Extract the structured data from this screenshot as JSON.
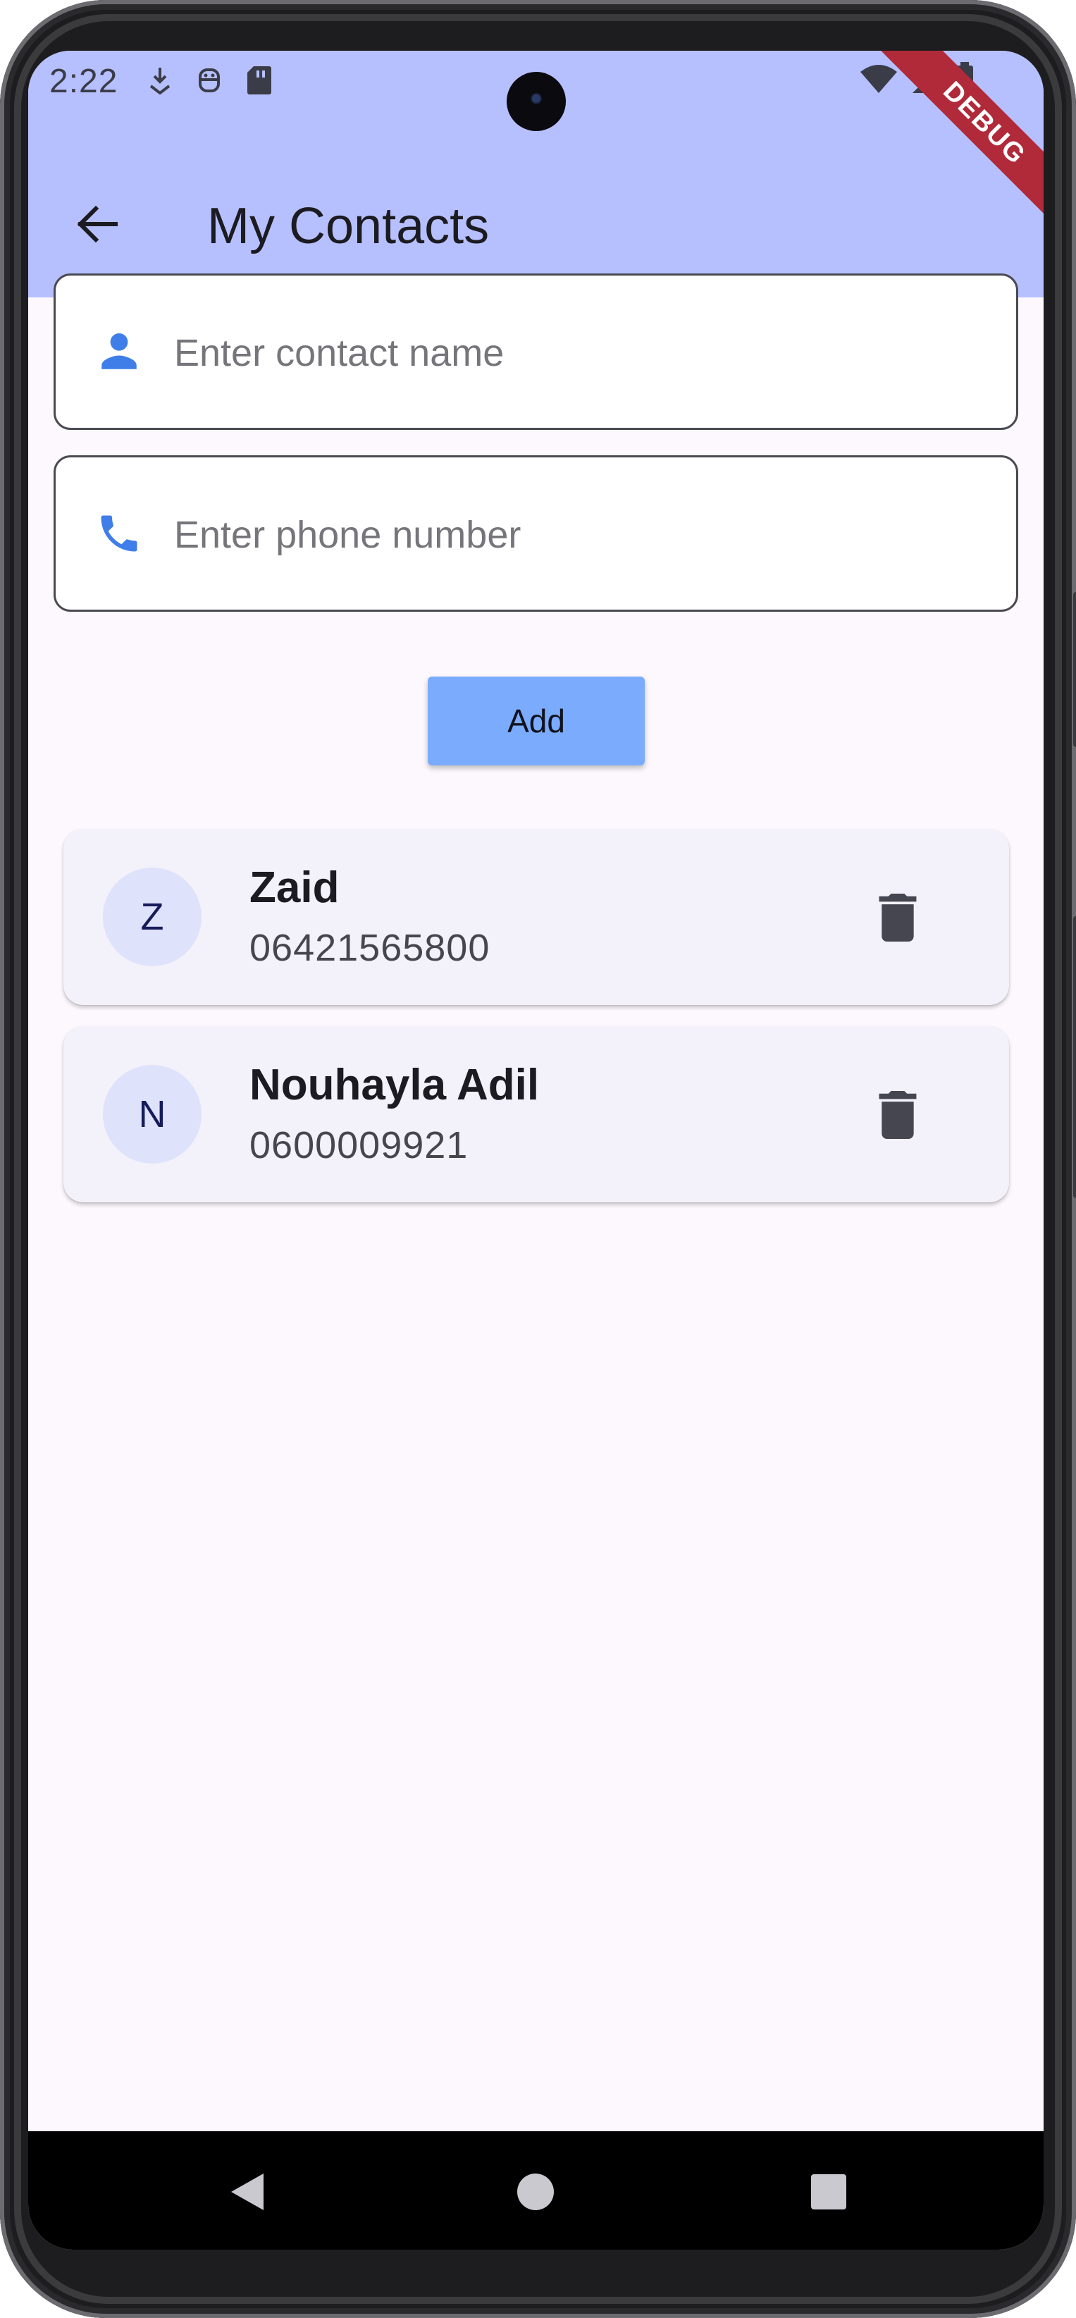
{
  "status_bar": {
    "time": "2:22",
    "left_icons": [
      "download-notification-icon",
      "android-debug-icon",
      "sd-card-icon"
    ],
    "right_icons": [
      "wifi-icon",
      "cell-signal-icon",
      "battery-icon"
    ]
  },
  "debug_banner": "DEBUG",
  "app_bar": {
    "title": "My Contacts",
    "back_icon": "arrow-back-icon",
    "color": "#b7c0ff"
  },
  "form": {
    "name_placeholder": "Enter contact name",
    "name_value": "",
    "phone_placeholder": "Enter phone number",
    "phone_value": "",
    "add_label": "Add",
    "icon_color": "#3f7ee8",
    "button_color": "#7aabfd"
  },
  "contacts": [
    {
      "initial": "Z",
      "name": "Zaid",
      "phone": "06421565800"
    },
    {
      "initial": "N",
      "name": "Nouhayla Adil",
      "phone": "0600009921"
    }
  ],
  "nav_bar": {
    "icons": [
      "nav-back-icon",
      "nav-home-icon",
      "nav-recents-icon"
    ]
  }
}
